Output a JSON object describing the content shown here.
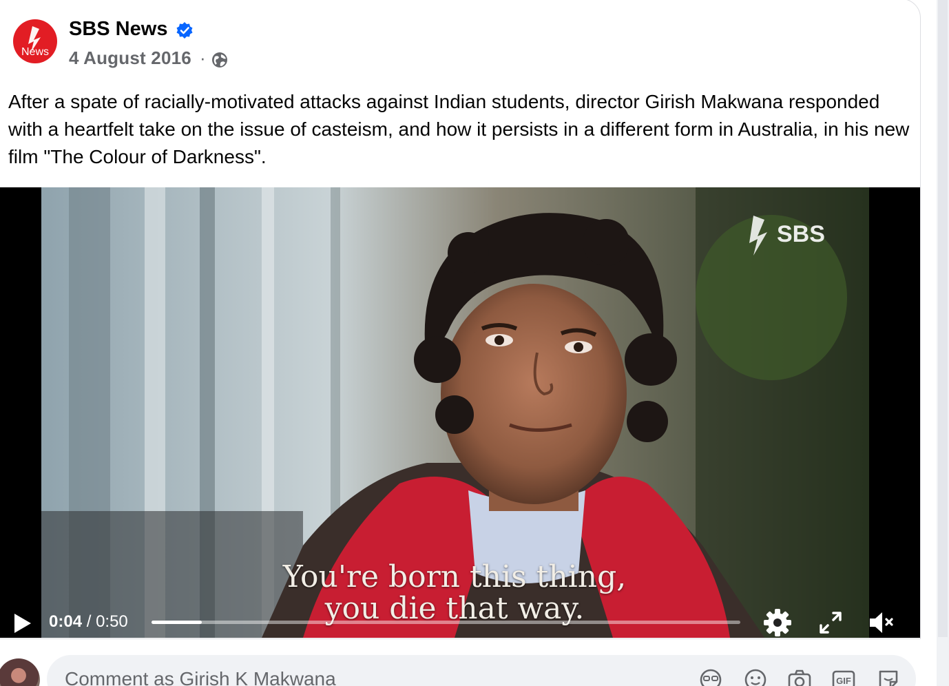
{
  "post": {
    "page_name": "SBS News",
    "avatar_label": "News",
    "date": "4 August 2016",
    "separator": "·",
    "text": "After a spate of racially-motivated attacks against Indian students, director Girish Makwana responded with a heartfelt take on the issue of casteism, and how it persists in a different form in Australia, in his new film \"The Colour of Darkness\"."
  },
  "video": {
    "watermark": "SBS",
    "subtitle_line1": "You're born this thing,",
    "subtitle_line2": "you die that way.",
    "current_time": "0:04",
    "time_separator": "/",
    "duration": "0:50",
    "progress_fraction": 0.085
  },
  "comment": {
    "placeholder": "Comment as Girish K Makwana",
    "icons": [
      "avatar-sticker-icon",
      "emoji-icon",
      "camera-icon",
      "gif-icon",
      "sticker-icon"
    ]
  },
  "colors": {
    "brand_red": "#e21d24",
    "verified_blue": "#0866ff",
    "secondary_text": "#65676b"
  }
}
